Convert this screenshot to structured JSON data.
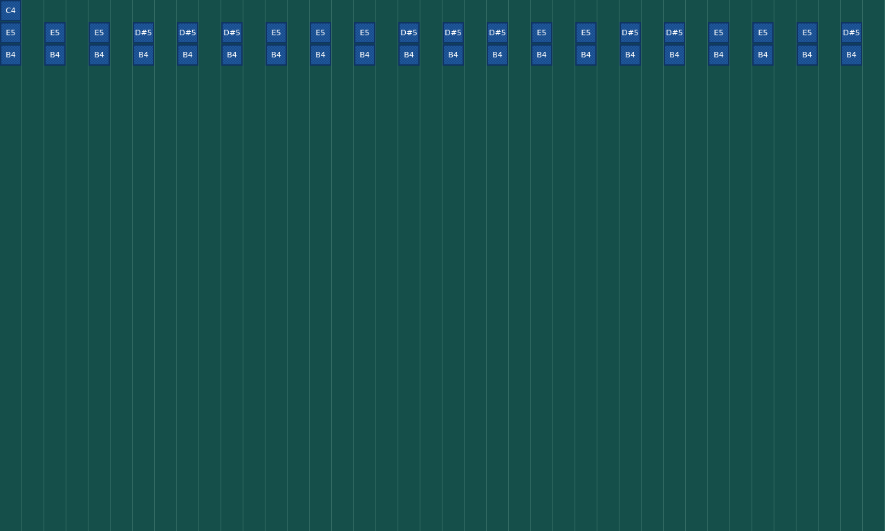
{
  "steps": [
    {
      "row_1": "C4",
      "row_2": "E5",
      "row_3": "B4"
    },
    {
      "row_2": "E5",
      "row_3": "B4"
    },
    {
      "row_2": "E5",
      "row_3": "B4"
    },
    {
      "row_2": "D#5",
      "row_3": "B4"
    },
    {
      "row_2": "D#5",
      "row_3": "B4"
    },
    {
      "row_2": "D#5",
      "row_3": "B4"
    },
    {
      "row_2": "E5",
      "row_3": "B4"
    },
    {
      "row_2": "E5",
      "row_3": "B4"
    },
    {
      "row_2": "E5",
      "row_3": "B4"
    },
    {
      "row_2": "D#5",
      "row_3": "B4"
    },
    {
      "row_2": "D#5",
      "row_3": "B4"
    },
    {
      "row_2": "D#5",
      "row_3": "B4"
    },
    {
      "row_2": "E5",
      "row_3": "B4"
    },
    {
      "row_2": "E5",
      "row_3": "B4"
    },
    {
      "row_2": "D#5",
      "row_3": "B4"
    },
    {
      "row_2": "D#5",
      "row_3": "B4"
    },
    {
      "row_2": "E5",
      "row_3": "B4"
    },
    {
      "row_2": "E5",
      "row_3": "B4"
    },
    {
      "row_2": "E5",
      "row_3": "B4"
    },
    {
      "row_2": "D#5",
      "row_3": "B4"
    }
  ]
}
